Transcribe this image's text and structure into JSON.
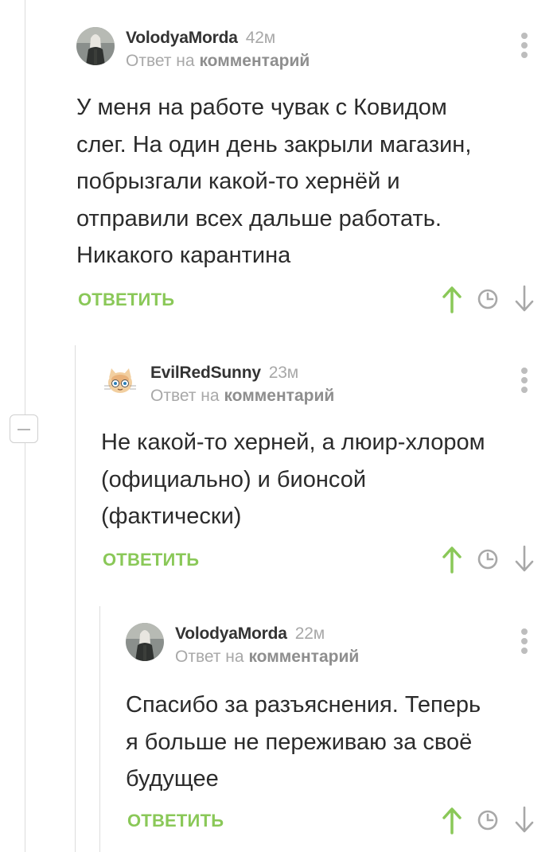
{
  "reply_to": {
    "prefix": "Ответ на",
    "target": "комментарий"
  },
  "actions": {
    "reply_label": "ОТВЕТИТЬ",
    "upvote_icon": "arrow-up-icon",
    "history_icon": "clock-icon",
    "downvote_icon": "arrow-down-icon",
    "menu_icon": "more-vertical-icon"
  },
  "colors": {
    "accent_green": "#8ac858",
    "muted_text": "#a8a8a8",
    "thread_line": "#dcdcdc"
  },
  "comments": [
    {
      "author": "VolodyaMorda",
      "time": "42м",
      "lines": [
        "У меня на работе чувак с Ковидом",
        "слег. На один день закрыли магазин,",
        "побрызгали какой-то хернёй и",
        "отправили всех дальше работать.",
        "Никакого карантина"
      ]
    },
    {
      "author": "EvilRedSunny",
      "time": "23м",
      "lines": [
        "Не какой-то херней, а люир-хлором",
        "(официально) и бионсой",
        "(фактически)"
      ]
    },
    {
      "author": "VolodyaMorda",
      "time": "22м",
      "lines": [
        "Спасибо за разъяснения. Теперь",
        "я больше не переживаю за своё",
        "будущее"
      ]
    }
  ]
}
